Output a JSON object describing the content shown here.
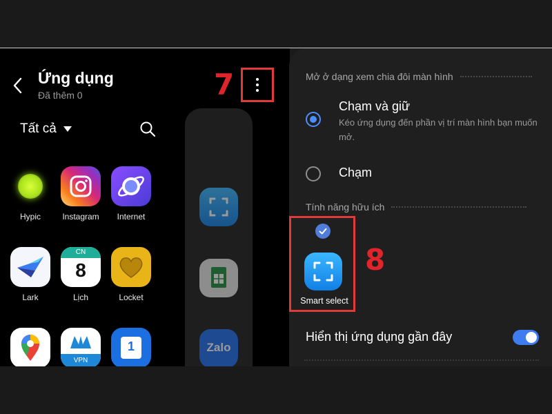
{
  "header": {
    "title": "Ứng dụng",
    "subtitle": "Đã thêm 0",
    "step_label_left": "7"
  },
  "filter": {
    "label": "Tất cả"
  },
  "apps": [
    {
      "label": "Hypic",
      "icon": "hypic-icon"
    },
    {
      "label": "Instagram",
      "icon": "instagram-icon"
    },
    {
      "label": "Internet",
      "icon": "internet-icon"
    },
    {
      "label": "Lark",
      "icon": "lark-icon"
    },
    {
      "label": "Lịch",
      "icon": "calendar-icon",
      "badge_day": "CN",
      "badge_num": "8"
    },
    {
      "label": "Locket",
      "icon": "locket-icon"
    },
    {
      "label": "",
      "icon": "maps-icon"
    },
    {
      "label": "",
      "icon": "vpn-icon",
      "badge_text": "VPN"
    },
    {
      "label": "",
      "icon": "dual-sim-icon",
      "badge_text": "1"
    }
  ],
  "recent_apps": [
    {
      "icon": "smart-select-icon"
    },
    {
      "icon": "sheets-icon"
    },
    {
      "icon": "zalo-icon",
      "text": "Zalo"
    }
  ],
  "settings": {
    "section_split": "Mở ở dạng xem chia đôi màn hình",
    "option_hold": {
      "title": "Chạm và giữ",
      "desc": "Kéo ứng dụng đến phần vị trí màn hình bạn muốn mở.",
      "selected": true
    },
    "option_tap": {
      "title": "Chạm",
      "selected": false
    },
    "section_useful": "Tính năng hữu ích",
    "feature": {
      "label": "Smart select",
      "checked": true
    },
    "step_label_right": "8",
    "recent_toggle": {
      "label": "Hiển thị ứng dụng gần đây",
      "on": true
    }
  },
  "colors": {
    "accent": "#3f7cf0",
    "highlight_red": "#e0242b",
    "panel_bg": "#1f1f1f"
  }
}
